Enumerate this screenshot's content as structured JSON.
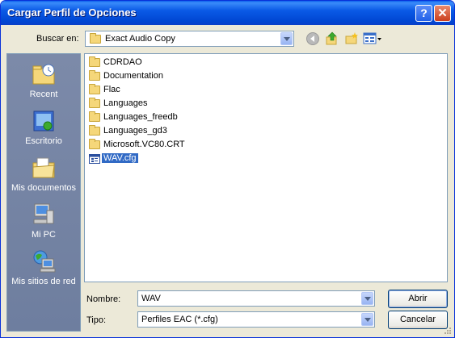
{
  "window": {
    "title": "Cargar Perfil de Opciones",
    "help": "?",
    "close": "✕"
  },
  "lookin": {
    "label": "Buscar en:",
    "value": "Exact Audio Copy"
  },
  "places": [
    {
      "label": "Recent"
    },
    {
      "label": "Escritorio"
    },
    {
      "label": "Mis documentos"
    },
    {
      "label": "Mi PC"
    },
    {
      "label": "Mis sitios de red"
    }
  ],
  "files": [
    {
      "name": "CDRDAO",
      "type": "folder"
    },
    {
      "name": "Documentation",
      "type": "folder"
    },
    {
      "name": "Flac",
      "type": "folder"
    },
    {
      "name": "Languages",
      "type": "folder"
    },
    {
      "name": "Languages_freedb",
      "type": "folder"
    },
    {
      "name": "Languages_gd3",
      "type": "folder"
    },
    {
      "name": "Microsoft.VC80.CRT",
      "type": "folder"
    },
    {
      "name": "WAV.cfg",
      "type": "file",
      "selected": true
    }
  ],
  "filename": {
    "label": "Nombre:",
    "value": "WAV"
  },
  "filetype": {
    "label": "Tipo:",
    "value": "Perfiles EAC (*.cfg)"
  },
  "buttons": {
    "open": "Abrir",
    "cancel": "Cancelar"
  }
}
